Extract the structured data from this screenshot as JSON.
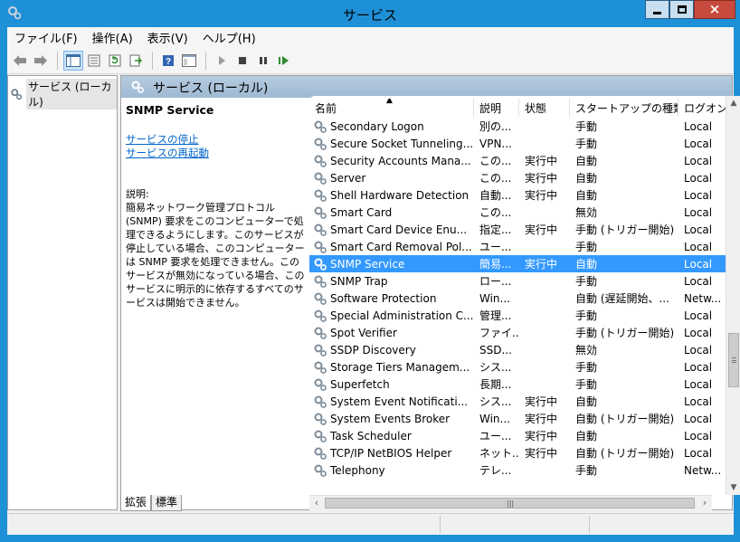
{
  "window": {
    "title": "サービス",
    "controls": {
      "minimize": "minimize",
      "maximize": "maximize",
      "close": "×"
    }
  },
  "menu": [
    "ファイル(F)",
    "操作(A)",
    "表示(V)",
    "ヘルプ(H)"
  ],
  "toolbar": {
    "icons": [
      "back-icon",
      "forward-icon",
      "show-hide-console-tree-icon",
      "properties-icon",
      "refresh-icon",
      "export-list-icon",
      "help-icon",
      "console-icon",
      "start-service-icon",
      "stop-service-icon",
      "pause-service-icon",
      "restart-service-icon"
    ]
  },
  "tree": {
    "root_label": "サービス (ローカル)"
  },
  "main": {
    "header_title": "サービス (ローカル)",
    "description": {
      "service_name": "SNMP Service",
      "stop_link": "サービスの停止",
      "restart_link": "サービスの再起動",
      "label": "説明:",
      "text": "簡易ネットワーク管理プロトコル (SNMP) 要求をこのコンピューターで処理できるようにします。このサービスが停止している場合、このコンピューターは SNMP 要求を処理できません。このサービスが無効になっている場合、このサービスに明示的に依存するすべてのサービスは開始できません。"
    },
    "columns": [
      "名前",
      "説明",
      "状態",
      "スタートアップの種類",
      "ログオン"
    ],
    "services": [
      {
        "name": "Secondary Logon",
        "desc": "別の...",
        "status": "",
        "startup": "手動",
        "logon": "Local"
      },
      {
        "name": "Secure Socket Tunneling...",
        "desc": "VPN...",
        "status": "",
        "startup": "手動",
        "logon": "Local"
      },
      {
        "name": "Security Accounts Mana...",
        "desc": "この...",
        "status": "実行中",
        "startup": "自動",
        "logon": "Local"
      },
      {
        "name": "Server",
        "desc": "この...",
        "status": "実行中",
        "startup": "自動",
        "logon": "Local"
      },
      {
        "name": "Shell Hardware Detection",
        "desc": "自動...",
        "status": "実行中",
        "startup": "自動",
        "logon": "Local"
      },
      {
        "name": "Smart Card",
        "desc": "この...",
        "status": "",
        "startup": "無効",
        "logon": "Local"
      },
      {
        "name": "Smart Card Device Enu...",
        "desc": "指定...",
        "status": "実行中",
        "startup": "手動 (トリガー開始)",
        "logon": "Local"
      },
      {
        "name": "Smart Card Removal Pol...",
        "desc": "ユー...",
        "status": "",
        "startup": "手動",
        "logon": "Local"
      },
      {
        "name": "SNMP Service",
        "desc": "簡易...",
        "status": "実行中",
        "startup": "自動",
        "logon": "Local",
        "selected": true
      },
      {
        "name": "SNMP Trap",
        "desc": "ロー...",
        "status": "",
        "startup": "手動",
        "logon": "Local"
      },
      {
        "name": "Software Protection",
        "desc": "Win...",
        "status": "",
        "startup": "自動 (遅延開始、...",
        "logon": "Netw..."
      },
      {
        "name": "Special Administration C...",
        "desc": "管理...",
        "status": "",
        "startup": "手動",
        "logon": "Local"
      },
      {
        "name": "Spot Verifier",
        "desc": "ファイ...",
        "status": "",
        "startup": "手動 (トリガー開始)",
        "logon": "Local"
      },
      {
        "name": "SSDP Discovery",
        "desc": "SSD...",
        "status": "",
        "startup": "無効",
        "logon": "Local"
      },
      {
        "name": "Storage Tiers Managem...",
        "desc": "シス...",
        "status": "",
        "startup": "手動",
        "logon": "Local"
      },
      {
        "name": "Superfetch",
        "desc": "長期...",
        "status": "",
        "startup": "手動",
        "logon": "Local"
      },
      {
        "name": "System Event Notificati...",
        "desc": "シス...",
        "status": "実行中",
        "startup": "自動",
        "logon": "Local"
      },
      {
        "name": "System Events Broker",
        "desc": "Win...",
        "status": "実行中",
        "startup": "自動 (トリガー開始)",
        "logon": "Local"
      },
      {
        "name": "Task Scheduler",
        "desc": "ユー...",
        "status": "実行中",
        "startup": "自動",
        "logon": "Local"
      },
      {
        "name": "TCP/IP NetBIOS Helper",
        "desc": "ネット...",
        "status": "実行中",
        "startup": "自動 (トリガー開始)",
        "logon": "Local"
      },
      {
        "name": "Telephony",
        "desc": "テレ...",
        "status": "",
        "startup": "手動",
        "logon": "Netw..."
      }
    ]
  },
  "tabs": [
    "拡張",
    "標準"
  ]
}
